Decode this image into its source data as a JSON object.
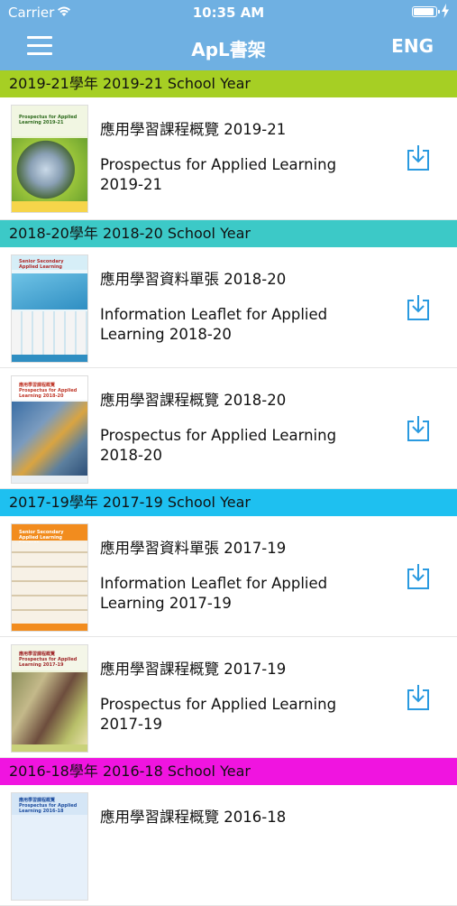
{
  "status": {
    "carrier": "Carrier",
    "time": "10:35 AM",
    "battery_level": 0.84
  },
  "navbar": {
    "title": "ApL書架",
    "lang_label": "ENG",
    "menu_icon": "hamburger-icon"
  },
  "colors": {
    "nav": "#6fb0e2",
    "s2019": "#a6cf24",
    "s2018": "#3cc9c7",
    "s2017": "#1ec0f0",
    "s2016": "#f014e0",
    "download": "#2a9ae0"
  },
  "sections": [
    {
      "header": "2019-21學年 2019-21 School Year",
      "items": [
        {
          "zh": "應用學習課程概覽 2019-21",
          "en": "Prospectus for Applied Learning 2019-21",
          "cover_title": "Prospectus for Applied Learning 2019-21"
        }
      ]
    },
    {
      "header": "2018-20學年 2018-20 School Year",
      "items": [
        {
          "zh": "應用學習資料單張 2018-20",
          "en": "Information Leaflet for Applied Learning 2018-20",
          "cover_title": "Senior Secondary Applied Learning"
        },
        {
          "zh": "應用學習課程概覽 2018-20",
          "en": "Prospectus for Applied Learning 2018-20",
          "cover_title": "應用學習課程概覽 Prospectus for Applied Learning 2018-20"
        }
      ]
    },
    {
      "header": "2017-19學年 2017-19 School Year",
      "items": [
        {
          "zh": "應用學習資料單張 2017-19",
          "en": "Information Leaflet for Applied Learning 2017-19",
          "cover_title": "Senior Secondary Applied Learning Courses"
        },
        {
          "zh": "應用學習課程概覽 2017-19",
          "en": "Prospectus for Applied Learning 2017-19",
          "cover_title": "應用學習課程概覽 Prospectus for Applied Learning 2017-19"
        }
      ]
    },
    {
      "header": "2016-18學年 2016-18 School Year",
      "items": [
        {
          "zh": "應用學習課程概覽 2016-18",
          "en": "",
          "cover_title": "應用學習課程概覽 Prospectus for Applied Learning 2016-18"
        }
      ]
    }
  ]
}
